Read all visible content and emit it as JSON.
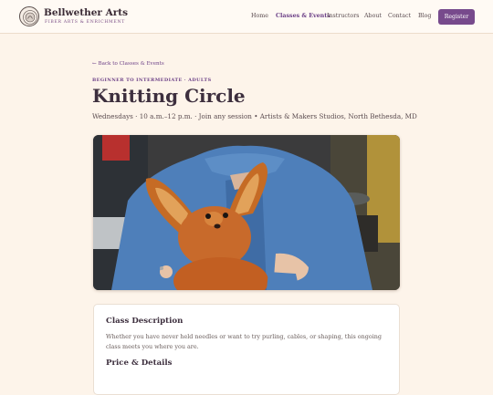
{
  "brand": {
    "name": "Bellwether Arts",
    "tagline": "FIBER ARTS & ENRICHMENT"
  },
  "nav": {
    "items": [
      "Home",
      "Classes & Events",
      "Instructors",
      "About",
      "Contact",
      "Blog"
    ],
    "active": "Classes & Events",
    "register_label": "Register"
  },
  "page": {
    "back_link": "← Back to Classes & Events",
    "eyebrow": "BEGINNER TO INTERMEDIATE · ADULTS",
    "title": "Knitting Circle",
    "meta": "Wednesdays · 10 a.m.–12 p.m. · Join any session • Artists & Makers Studios, North Bethesda, MD"
  },
  "description": {
    "heading": "Class Description",
    "body": "Whether you have never held needles or want to try purling, cables, or shaping, this ongoing class meets you where you are."
  },
  "price": {
    "heading": "Price & Details"
  },
  "colors": {
    "accent": "#774a8c",
    "background": "#fdf4ea"
  }
}
